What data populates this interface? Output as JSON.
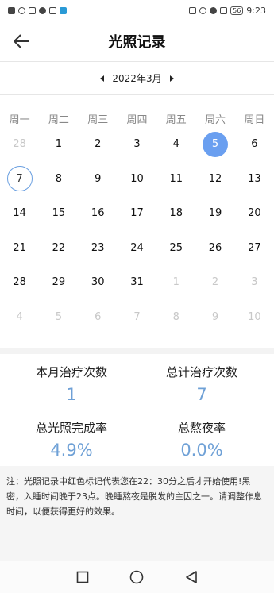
{
  "status_bar": {
    "left_icons": [
      "notification-icon",
      "wifi-icon",
      "usb-icon",
      "app-icon",
      "app-icon",
      "app-icon"
    ],
    "battery": "56",
    "time": "9:23"
  },
  "header": {
    "title": "光照记录"
  },
  "month_nav": {
    "label": "2022年3月"
  },
  "weekdays": [
    "周一",
    "周二",
    "周三",
    "周四",
    "周五",
    "周六",
    "周日"
  ],
  "calendar": [
    {
      "d": "28",
      "other": true
    },
    {
      "d": "1"
    },
    {
      "d": "2"
    },
    {
      "d": "3"
    },
    {
      "d": "4"
    },
    {
      "d": "5",
      "selected": true
    },
    {
      "d": "6"
    },
    {
      "d": "7",
      "today": true
    },
    {
      "d": "8"
    },
    {
      "d": "9"
    },
    {
      "d": "10"
    },
    {
      "d": "11"
    },
    {
      "d": "12"
    },
    {
      "d": "13"
    },
    {
      "d": "14"
    },
    {
      "d": "15"
    },
    {
      "d": "16"
    },
    {
      "d": "17"
    },
    {
      "d": "18"
    },
    {
      "d": "19"
    },
    {
      "d": "20"
    },
    {
      "d": "21"
    },
    {
      "d": "22"
    },
    {
      "d": "23"
    },
    {
      "d": "24"
    },
    {
      "d": "25"
    },
    {
      "d": "26"
    },
    {
      "d": "27"
    },
    {
      "d": "28"
    },
    {
      "d": "29"
    },
    {
      "d": "30"
    },
    {
      "d": "31"
    },
    {
      "d": "1",
      "other": true
    },
    {
      "d": "2",
      "other": true
    },
    {
      "d": "3",
      "other": true
    },
    {
      "d": "4",
      "other": true
    },
    {
      "d": "5",
      "other": true
    },
    {
      "d": "6",
      "other": true
    },
    {
      "d": "7",
      "other": true
    },
    {
      "d": "8",
      "other": true
    },
    {
      "d": "9",
      "other": true
    },
    {
      "d": "10",
      "other": true
    }
  ],
  "stats": {
    "monthly_label": "本月治疗次数",
    "monthly_value": "1",
    "total_label": "总计治疗次数",
    "total_value": "7",
    "completion_label": "总光照完成率",
    "completion_value": "4.9%",
    "late_label": "总熬夜率",
    "late_value": "0.0%"
  },
  "note": "注：光照记录中红色标记代表您在22：30分之后才开始使用!黑密，入睡时间晚于23点。晚睡熬夜是脱发的主因之一。请调整作息时间，以便获得更好的效果。",
  "colors": {
    "accent": "#6a9ff0",
    "value": "#6ea0d6"
  }
}
